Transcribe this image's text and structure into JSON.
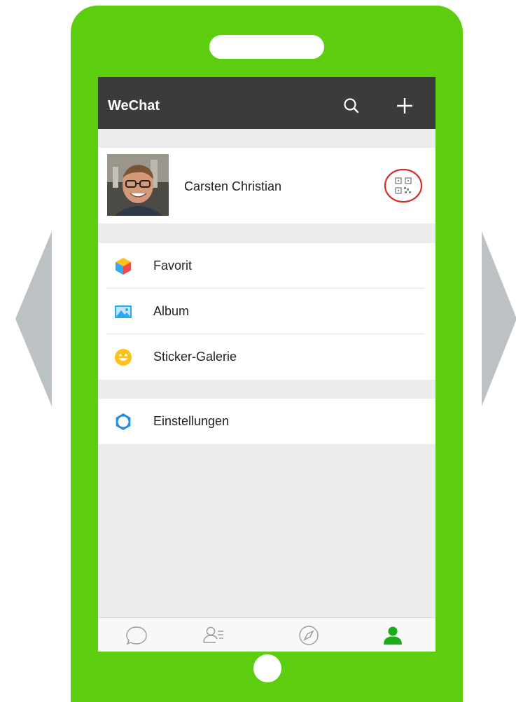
{
  "app": {
    "title": "WeChat"
  },
  "toolbar": {
    "search_icon": "search-icon",
    "add_icon": "plus-icon"
  },
  "profile": {
    "name": "Carsten Christian",
    "qr_icon": "qr-code-icon"
  },
  "menu": {
    "group1": [
      {
        "label": "Favorit",
        "icon": "favorites-cube-icon"
      },
      {
        "label": "Album",
        "icon": "album-photo-icon"
      },
      {
        "label": "Sticker-Galerie",
        "icon": "sticker-smiley-icon"
      }
    ],
    "group2": [
      {
        "label": "Einstellungen",
        "icon": "settings-gear-icon"
      }
    ]
  },
  "tabs": [
    {
      "icon": "chats-icon",
      "active": false
    },
    {
      "icon": "contacts-icon",
      "active": false
    },
    {
      "icon": "discover-compass-icon",
      "active": false
    },
    {
      "icon": "me-person-icon",
      "active": true
    }
  ],
  "colors": {
    "phone_body": "#5ccd0f",
    "titlebar": "#3b3b3e",
    "active_tab": "#1aad19",
    "qr_highlight": "#d52b2b",
    "arrow": "#bcc1c3"
  }
}
